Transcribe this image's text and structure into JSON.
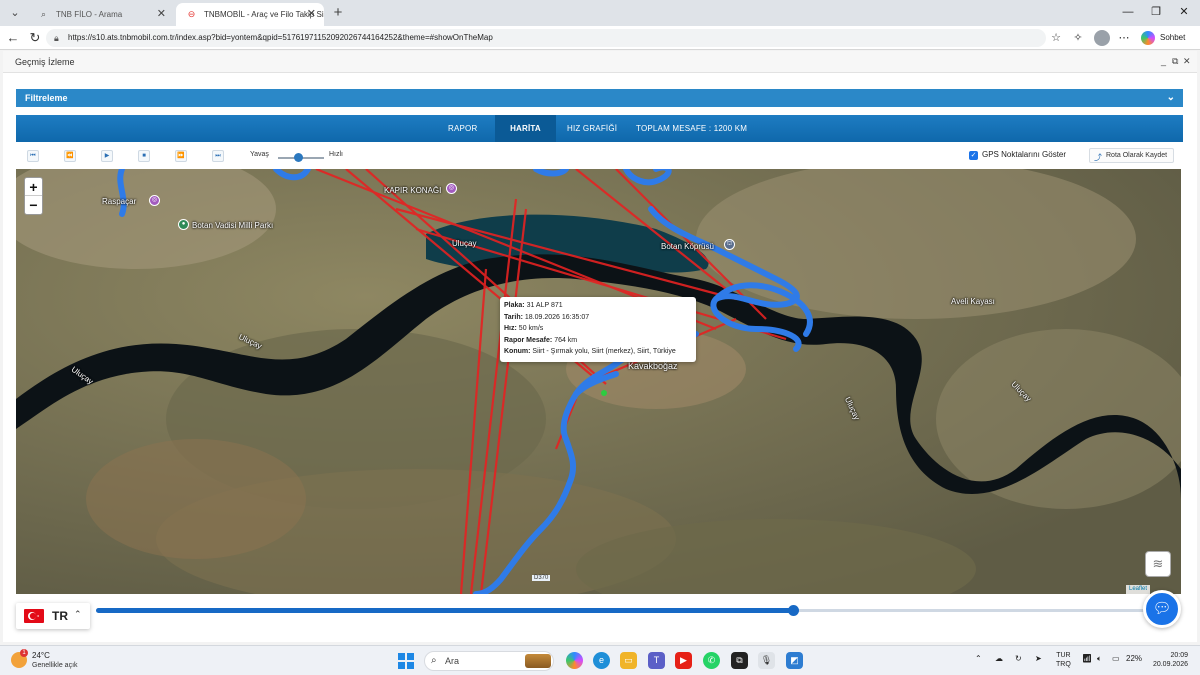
{
  "browser": {
    "tabs": [
      {
        "title": "TNB FİLO - Arama",
        "active": false
      },
      {
        "title": "TNBMOBİL - Araç ve Filo Takip Sis",
        "active": true
      }
    ],
    "url": "https://s10.ats.tnbmobil.com.tr/index.asp?bid=yontem&qpid=51761971152092026744164252&theme=#showOnTheMap",
    "copilot_label": "Sohbet et"
  },
  "window": {
    "title": "Geçmiş İzleme"
  },
  "filter": {
    "label": "Filtreleme"
  },
  "nav_tabs": [
    {
      "label": "RAPOR",
      "active": false
    },
    {
      "label": "HARİTA",
      "active": true
    },
    {
      "label": "HIZ GRAFİĞİ",
      "active": false
    },
    {
      "label": "TOPLAM MESAFE : 1200 KM",
      "active": false
    }
  ],
  "controls": {
    "slow_label": "Yavaş",
    "fast_label": "Hızlı",
    "speed_level": 0.45,
    "gps_points_label": "GPS Noktalarını Göster",
    "gps_points_checked": true,
    "save_route_label": "Rota Olarak Kaydet"
  },
  "map": {
    "zoom_in": "+",
    "zoom_out": "−",
    "labels": {
      "raspacar": "Raspaçar",
      "botan_park": "Botan Vadisi Milli Parkı",
      "kapir": "KAPIR KONAĞI",
      "ulucay1": "Uluçay",
      "ulucay2": "Uluçay",
      "ulucay3": "Uluçay",
      "ulucay4": "Uluçay",
      "ulucay5": "Uluçay",
      "botan_bridge": "Botan Köprüsü",
      "aveli": "Aveli Kayası",
      "kavakbogaz": "Kavakboğaz",
      "road": "D370"
    },
    "popup": {
      "plate_label": "Plaka:",
      "plate": "31 ALP 871",
      "date_label": "Tarih:",
      "date": "18.09.2026 16:35:07",
      "speed_label": "Hız:",
      "speed": "50 km/s",
      "distance_label": "Rapor Mesafe:",
      "distance": "764 km",
      "location_label": "Konum:",
      "location": "Siirt - Şırmak yolu, Siirt (merkez), Siirt, Türkiye"
    },
    "attribution": "Leaflet",
    "colors": {
      "route": "#2f7be8",
      "line": "#e52222",
      "river": "#0c1216"
    }
  },
  "timeline": {
    "progress": 0.655
  },
  "language": {
    "code": "TR"
  },
  "taskbar": {
    "temperature": "24°C",
    "weather": "Genellikle açık",
    "weather_badge": "1",
    "search_placeholder": "Ara",
    "lang_top": "TUR",
    "lang_bottom": "TRQ",
    "battery": "22%",
    "time": "20:09",
    "date": "20.09.2026"
  }
}
